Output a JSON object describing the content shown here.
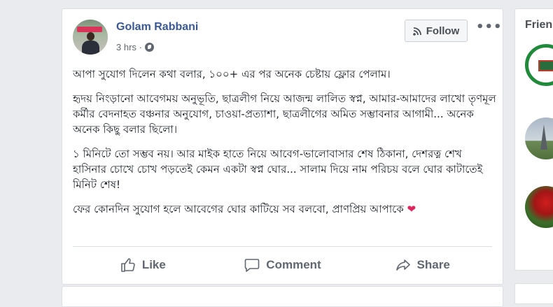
{
  "post": {
    "author": "Golam Rabbani",
    "time": "3 hrs ·",
    "follow_label": "Follow",
    "more_label": "•••",
    "paragraphs": [
      "আপা সুযোগ দিলেন কথা বলার, ১০০+ এর পর অনেক চেষ্টায় ফ্লোর পেলাম।",
      "হৃদয় নিংড়ানো আবেগময় অনুভূতি, ছাত্রলীগ নিয়ে আজন্ম লালিত স্বপ্ন, আমার-আমাদের লাখো তৃণমূল কর্মীর বেদনাহত বঞ্চনার অনুযোগ, চাওয়া-প্রত্যাশা, ছাত্রলীগের অমিত সম্ভাবনার আগামী... অনেক অনেক কিছু বলার ছিলো।",
      "১ মিনিটে তো সম্ভব নয়। আর মাইক হাতে নিয়ে আবেগ-ভালোবাসার শেষ ঠিকানা, দেশরত্ন শেখ হাসিনার চোখে চোখ পড়তেই কেমন একটা স্বপ্ন ঘোর... সালাম দিয়ে নাম পরিচয় বলে ঘোর কাটাতেই মিনিট শেষ!",
      "ফের কোনদিন সুযোগ হলে আবেগের ঘোর কাটিয়ে সব বলবো, প্রাণপ্রিয় আপাকে"
    ],
    "heart": "❤",
    "actions": {
      "like": "Like",
      "comment": "Comment",
      "share": "Share"
    }
  },
  "sidebar": {
    "title": "Frien"
  },
  "icons": {
    "follow": "rss-icon",
    "privacy": "globe-icon",
    "like": "thumbs-up-icon",
    "comment": "comment-bubble-icon",
    "share": "share-arrow-icon"
  },
  "colors": {
    "author_link": "#385898",
    "heart": "#e0245e",
    "action_text": "#606770"
  }
}
